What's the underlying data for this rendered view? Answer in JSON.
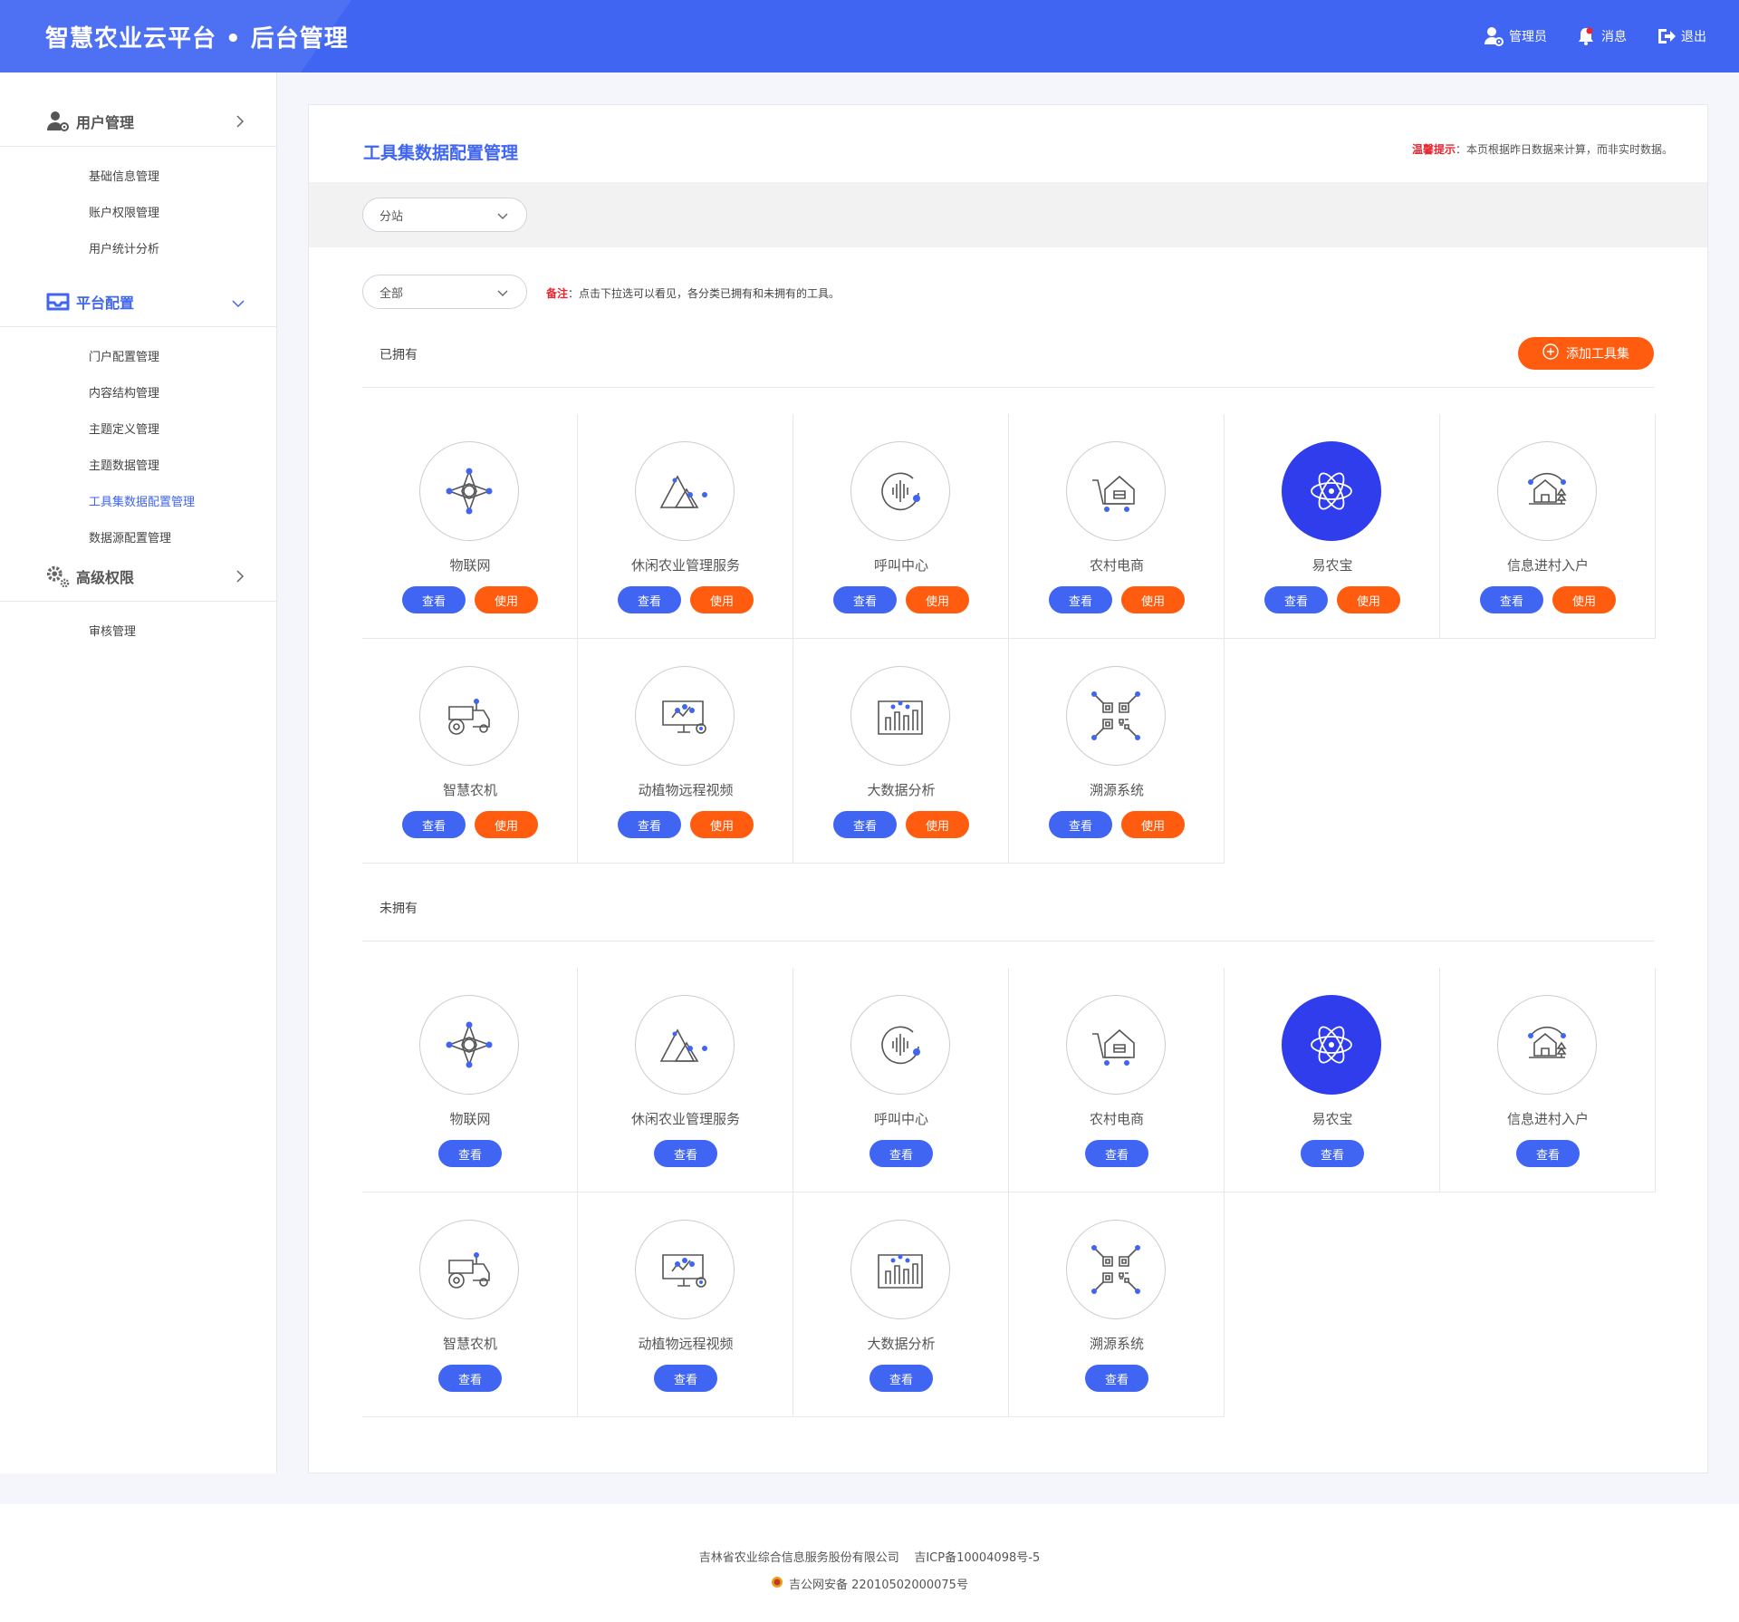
{
  "header": {
    "title": "智慧农业云平台 • 后台管理",
    "admin_label": "管理员",
    "message_label": "消息",
    "logout_label": "退出",
    "brand_color": "#3f65f2"
  },
  "sidebar": {
    "groups": [
      {
        "label": "用户管理",
        "icon": "user-gear-icon",
        "items": [
          "基础信息管理",
          "账户权限管理",
          "用户统计分析"
        ]
      },
      {
        "label": "平台配置",
        "icon": "inbox-icon",
        "items": [
          "门户配置管理",
          "内容结构管理",
          "主题定义管理",
          "主题数据管理",
          "工具集数据配置管理",
          "数据源配置管理"
        ]
      },
      {
        "label": "高级权限",
        "icon": "gears-icon",
        "items": [
          "审核管理"
        ]
      }
    ],
    "active_item": "工具集数据配置管理"
  },
  "main": {
    "title": "工具集数据配置管理",
    "tip_key": "温馨提示",
    "tip_text": "：本页根据昨日数据来计算，而非实时数据。",
    "station_select": "分站",
    "category_select": "全部",
    "note_key": "备注",
    "note_text": "：点击下拉选可以看见，各分类已拥有和未拥有的工具。",
    "owned_label": "已拥有",
    "not_owned_label": "未拥有",
    "add_button": "添加工具集",
    "view_label": "查看",
    "use_label": "使用",
    "accent_orange": "#ff5c0f"
  },
  "tools": [
    {
      "name": "物联网",
      "icon": "iot-drone-icon"
    },
    {
      "name": "休闲农业管理服务",
      "icon": "mountain-icon"
    },
    {
      "name": "呼叫中心",
      "icon": "voice-wave-icon"
    },
    {
      "name": "农村电商",
      "icon": "cart-shop-icon"
    },
    {
      "name": "易农宝",
      "icon": "atom-icon"
    },
    {
      "name": "信息进村入户",
      "icon": "village-house-icon"
    },
    {
      "name": "智慧农机",
      "icon": "tractor-icon"
    },
    {
      "name": "动植物远程视频",
      "icon": "monitor-camera-icon"
    },
    {
      "name": "大数据分析",
      "icon": "bar-chart-icon"
    },
    {
      "name": "溯源系统",
      "icon": "qr-code-icon"
    }
  ],
  "footer": {
    "company": "吉林省农业综合信息服务股份有限公司",
    "icp": "吉ICP备10004098号-5",
    "police": "吉公网安备 22010502000075号"
  }
}
